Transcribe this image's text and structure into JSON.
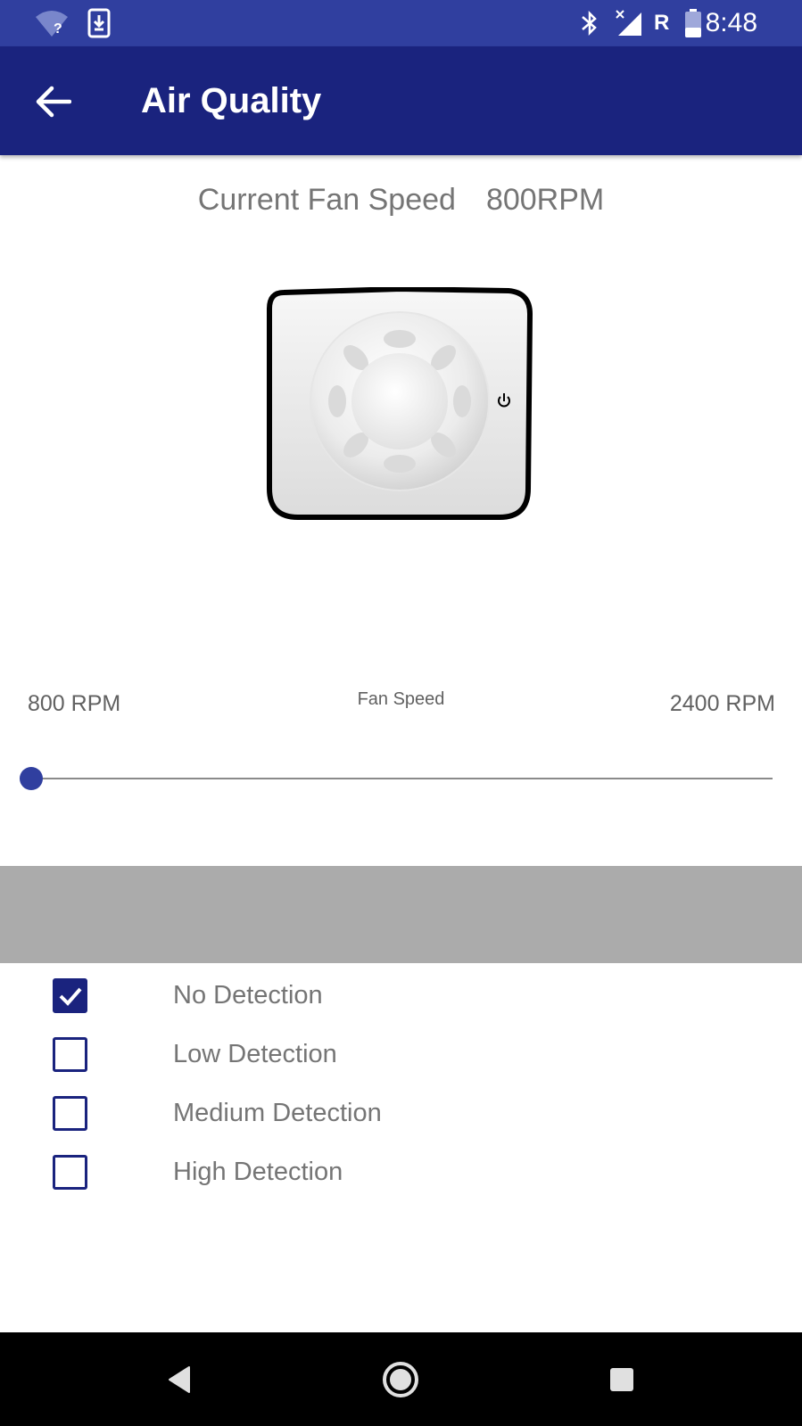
{
  "status_bar": {
    "time": "8:48",
    "roaming": "R",
    "icons": [
      "wifi-unknown-icon",
      "download-icon",
      "bluetooth-icon",
      "signal-icon",
      "battery-icon"
    ]
  },
  "app_bar": {
    "title": "Air Quality",
    "back_icon": "arrow-back-icon"
  },
  "fan": {
    "current_speed_label": "Current Fan Speed",
    "current_speed_value": "800RPM",
    "image": "fan-icon",
    "power_icon": "power-icon"
  },
  "slider": {
    "min_label": "800 RPM",
    "max_label": "2400 RPM",
    "label": "Fan Speed",
    "min": 800,
    "max": 2400,
    "value": 800,
    "accent_color": "#303f9f"
  },
  "detection": {
    "options": [
      {
        "label": "No Detection",
        "checked": true
      },
      {
        "label": "Low Detection",
        "checked": false
      },
      {
        "label": "Medium Detection",
        "checked": false
      },
      {
        "label": "High Detection",
        "checked": false
      }
    ]
  },
  "nav_bar": {
    "icons": [
      "back-triangle-icon",
      "home-circle-icon",
      "recents-square-icon"
    ]
  },
  "colors": {
    "status_bar": "#303f9f",
    "app_bar": "#1a237e",
    "gray_band": "#ababab",
    "text_gray": "#757575"
  }
}
